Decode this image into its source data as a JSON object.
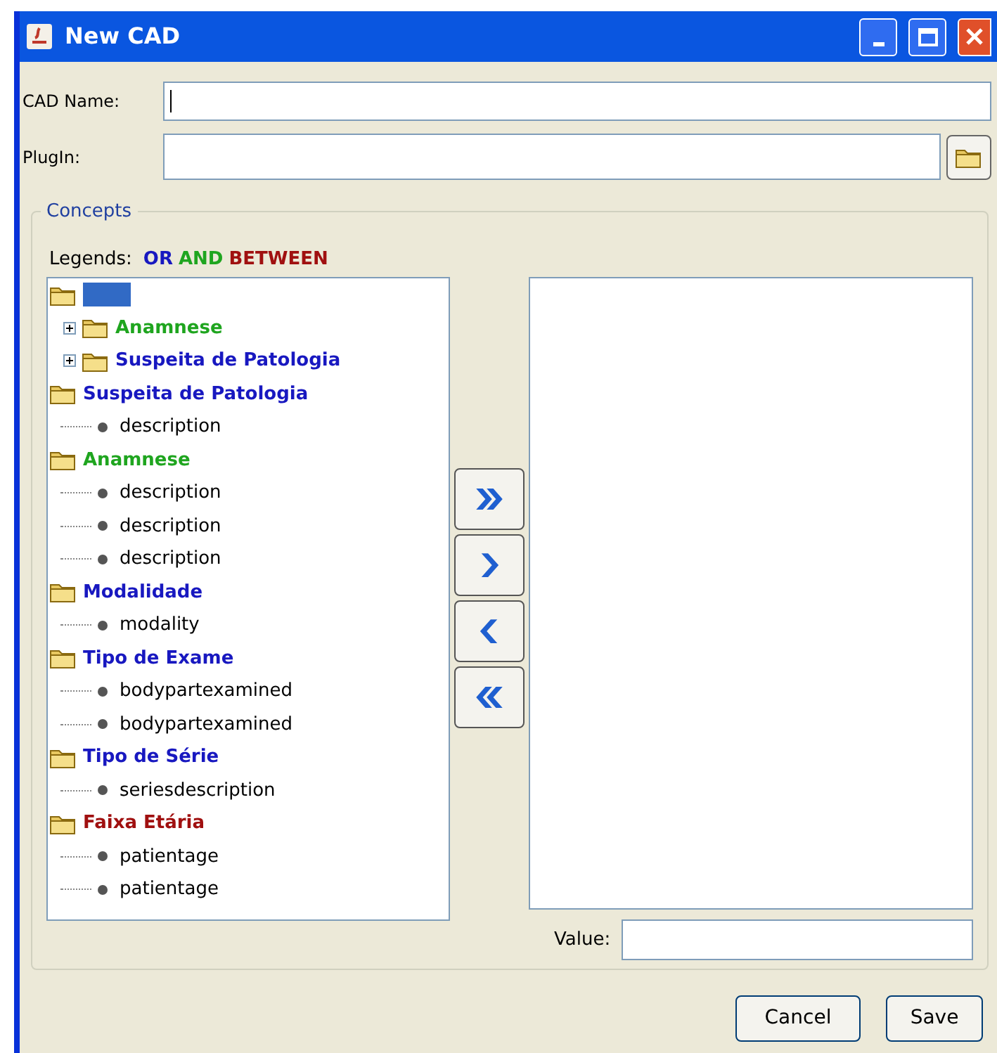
{
  "window": {
    "title": "New CAD"
  },
  "fields": [
    {
      "label": "CAD Name:",
      "focused": true
    },
    {
      "label": "PlugIn:",
      "focused": false,
      "browse": true
    }
  ],
  "concepts": {
    "title": "Concepts",
    "legend_label": "Legends:",
    "legends": [
      {
        "label": "OR",
        "color": "#1818c0"
      },
      {
        "label": "AND",
        "color": "#1fa51f"
      },
      {
        "label": "BETWEEN",
        "color": "#a01010"
      }
    ],
    "tree": [
      {
        "kind": "folder",
        "selected": true,
        "children": [
          {
            "kind": "folder",
            "label": "Anamnese",
            "color": "#1fa51f",
            "expanded": false
          },
          {
            "kind": "folder",
            "label": "Suspeita de Patologia",
            "color": "#1818c0",
            "expanded": false
          }
        ]
      },
      {
        "kind": "folder",
        "label": "Suspeita de Patologia",
        "color": "#1818c0",
        "children": [
          {
            "kind": "leaf",
            "label": "description"
          }
        ]
      },
      {
        "kind": "folder",
        "label": "Anamnese",
        "color": "#1fa51f",
        "children": [
          {
            "kind": "leaf",
            "label": "description"
          },
          {
            "kind": "leaf",
            "label": "description"
          },
          {
            "kind": "leaf",
            "label": "description"
          }
        ]
      },
      {
        "kind": "folder",
        "label": "Modalidade",
        "color": "#1818c0",
        "children": [
          {
            "kind": "leaf",
            "label": "modality"
          }
        ]
      },
      {
        "kind": "folder",
        "label": "Tipo de Exame",
        "color": "#1818c0",
        "children": [
          {
            "kind": "leaf",
            "label": "bodypartexamined"
          },
          {
            "kind": "leaf",
            "label": "bodypartexamined"
          }
        ]
      },
      {
        "kind": "folder",
        "label": "Tipo de Série",
        "color": "#1818c0",
        "children": [
          {
            "kind": "leaf",
            "label": "seriesdescription"
          }
        ]
      },
      {
        "kind": "folder",
        "label": "Faixa Etária",
        "color": "#a01010",
        "children": [
          {
            "kind": "leaf",
            "label": "patientage"
          },
          {
            "kind": "leaf",
            "label": "patientage"
          }
        ]
      }
    ],
    "move_buttons": [
      {
        "kind": "add-all"
      },
      {
        "kind": "add"
      },
      {
        "kind": "remove"
      },
      {
        "kind": "remove-all"
      }
    ],
    "value_label": "Value:"
  },
  "buttons": [
    "Cancel",
    "Save"
  ]
}
